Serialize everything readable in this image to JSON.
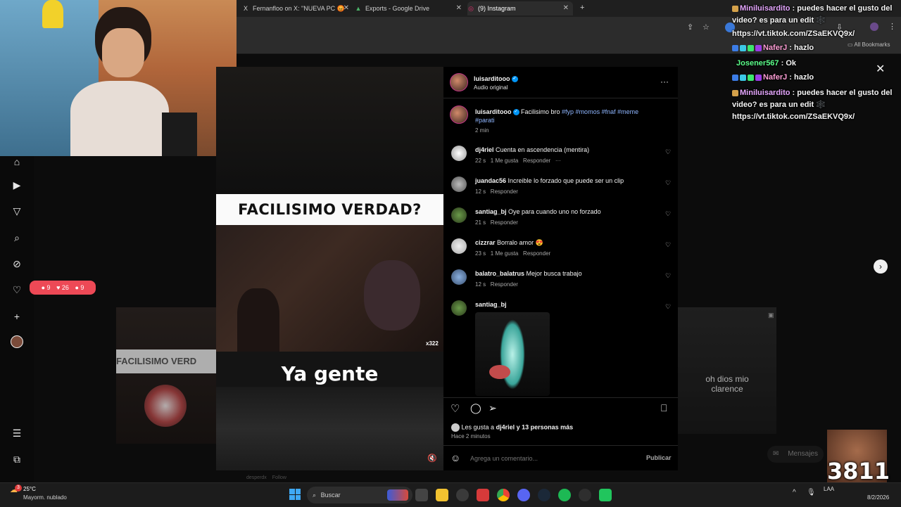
{
  "browser": {
    "tabs": [
      {
        "icon": "X",
        "label": "Fernanfloo on X: \"NUEVA PC 😡"
      },
      {
        "icon": "▲",
        "label": "Exports - Google Drive"
      },
      {
        "icon": "◎",
        "label": "(9) Instagram"
      }
    ],
    "bookmarks_label": "All Bookmarks"
  },
  "sidebar": {
    "notification_counts": {
      "comments": "9",
      "likes": "26",
      "follows": "9"
    }
  },
  "video": {
    "banner": "FACILISIMO VERDAD?",
    "subtitle": "Ya gente",
    "badge": "x322"
  },
  "post": {
    "author": "luisarditooo",
    "audio": "Audio original",
    "caption_user": "luisarditooo",
    "caption_text": "Facilisimo bro",
    "caption_tags": "#fyp #momos #fnaf #meme #parati",
    "caption_time": "2 min",
    "comments": [
      {
        "user": "dj4riel",
        "text": "Cuenta en ascendencia (mentira)",
        "time": "22 s",
        "likes": "1 Me gusta",
        "reply": "Responder",
        "more": "···"
      },
      {
        "user": "juandac56",
        "text": "Increible lo forzado que puede ser un clip",
        "time": "12 s",
        "likes": "",
        "reply": "Responder"
      },
      {
        "user": "santiag_bj",
        "text": "Oye para cuando uno no forzado",
        "time": "21 s",
        "likes": "",
        "reply": "Responder"
      },
      {
        "user": "cizzrar",
        "text": "Borralo amor 😍",
        "time": "23 s",
        "likes": "1 Me gusta",
        "reply": "Responder"
      },
      {
        "user": "balatro_balatrus",
        "text": "Mejor busca trabajo",
        "time": "12 s",
        "likes": "",
        "reply": "Responder"
      },
      {
        "user": "santiag_bj",
        "text": "",
        "time": "",
        "likes": "",
        "reply": ""
      }
    ],
    "likes_text_prefix": "Les gusta a",
    "likes_user": "dj4riel",
    "likes_text_suffix": "y 13 personas más",
    "posted": "Hace 2 minutos",
    "comment_placeholder": "Agrega un comentario...",
    "publish_label": "Publicar"
  },
  "background": {
    "left_thumb_text": "FACILISIMO VERD",
    "right_thumb_text": "oh dios mio\nclarence",
    "messages_label": "Mensajes",
    "ghost_user": "desperdx",
    "ghost_follow": "Follow"
  },
  "chat": [
    {
      "user": "Miniluisardito",
      "user_color": "#e6a7ff",
      "text": "puedes hacer el gusto del video? es para un edit 🕸️"
    },
    {
      "user": "",
      "user_color": "#ffffff",
      "text": "https://vt.tiktok.com/ZSaEKVQ9x/"
    },
    {
      "user": "NaferJ",
      "user_color": "#ff9fd6",
      "text": "hazlo"
    },
    {
      "user": "Josener567",
      "user_color": "#5cff8a",
      "text": "Ok"
    },
    {
      "user": "NaferJ",
      "user_color": "#ff9fd6",
      "text": "hazlo"
    },
    {
      "user": "Miniluisardito",
      "user_color": "#e6a7ff",
      "text": "puedes hacer el gusto del video? es para un edit 🕸️"
    },
    {
      "user": "",
      "user_color": "#ffffff",
      "text": "https://vt.tiktok.com/ZSaEKVQ9x/"
    }
  ],
  "taskbar": {
    "weather_temp": "25°C",
    "weather_desc": "Mayorm. nublado",
    "weather_badge": "3",
    "search_placeholder": "Buscar",
    "time": "",
    "date": "8/2/2026",
    "lang": "LAA",
    "overlay_number": "3811"
  }
}
